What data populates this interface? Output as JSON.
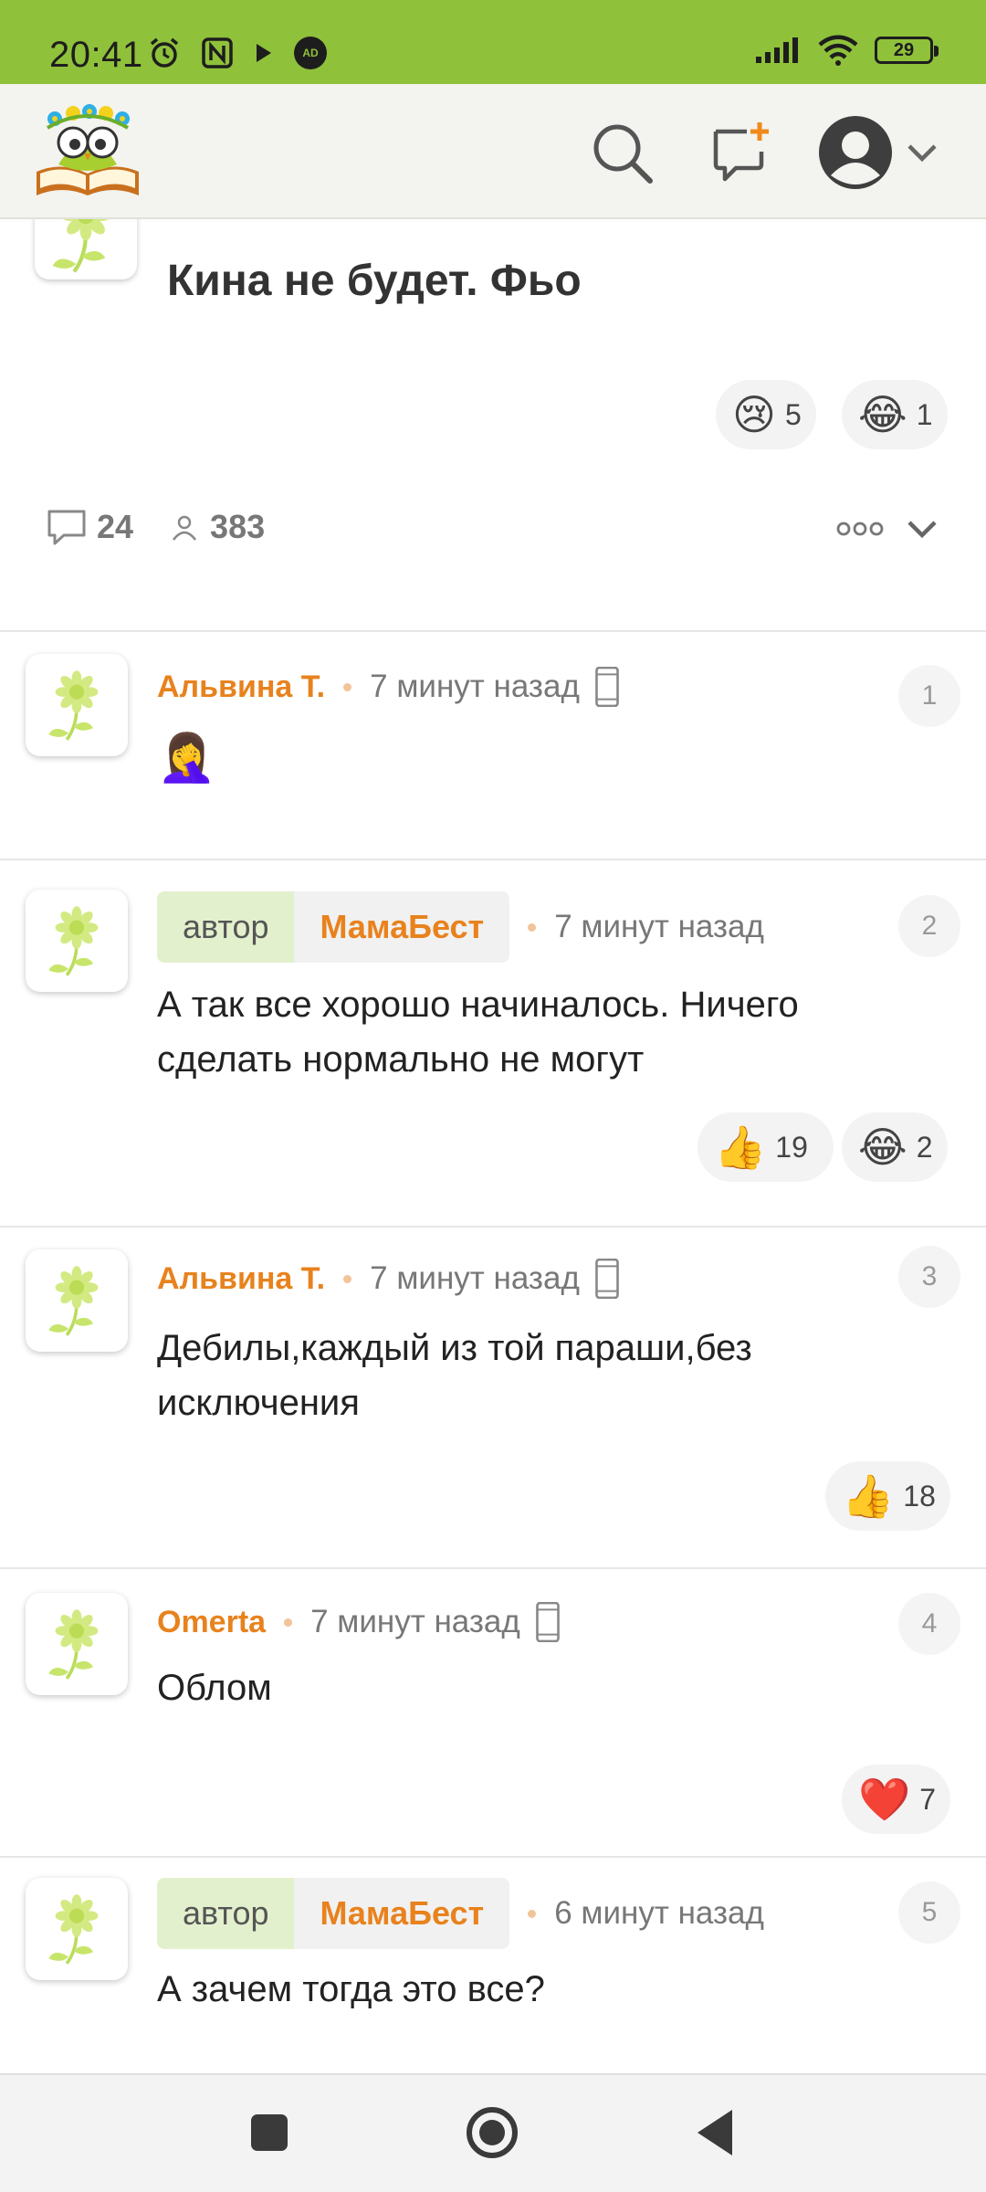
{
  "status_bar": {
    "time": "20:41",
    "battery": "29",
    "ad_badge": "AD"
  },
  "app_bar": {
    "logo": "owl-reader-logo",
    "icons": [
      "search-icon",
      "new-post-icon",
      "avatar-icon",
      "chevron-down-icon"
    ]
  },
  "post": {
    "title": "Кина не будет. Фьо",
    "reactions": [
      {
        "emoji": "😢",
        "count": "5"
      },
      {
        "emoji": "😂",
        "count": "1"
      }
    ],
    "comments_count": "24",
    "views_count": "383"
  },
  "comments": [
    {
      "number": "1",
      "author": "Альвина Т.",
      "is_author": false,
      "time": "7 минут назад",
      "mobile": true,
      "text": "🤦‍♀️",
      "reactions": []
    },
    {
      "number": "2",
      "author_role": "автор",
      "author": "МамаБест",
      "is_author": true,
      "time": "7 минут назад",
      "mobile": false,
      "text": "А так все хорошо начиналось. Ничего сделать нормально не могут",
      "reactions": [
        {
          "emoji": "👍",
          "count": "19"
        },
        {
          "emoji": "😂",
          "count": "2"
        }
      ]
    },
    {
      "number": "3",
      "author": "Альвина Т.",
      "is_author": false,
      "time": "7 минут назад",
      "mobile": true,
      "text": "Дебилы,каждый из той параши,без исключения",
      "reactions": [
        {
          "emoji": "👍",
          "count": "18"
        }
      ]
    },
    {
      "number": "4",
      "author": "Omerta",
      "is_author": false,
      "time": "7 минут назад",
      "mobile": true,
      "text": "Облом",
      "reactions": [
        {
          "emoji": "❤️",
          "count": "7"
        }
      ]
    },
    {
      "number": "5",
      "author_role": "автор",
      "author": "МамаБест",
      "is_author": true,
      "time": "6 минут назад",
      "mobile": false,
      "text": "А зачем тогда это все?",
      "reactions": []
    }
  ],
  "colors": {
    "status_bar": "#8fc13b",
    "author_name": "#e8821d",
    "author_badge": "#e3f0cd",
    "flower": "#c7e56a"
  }
}
